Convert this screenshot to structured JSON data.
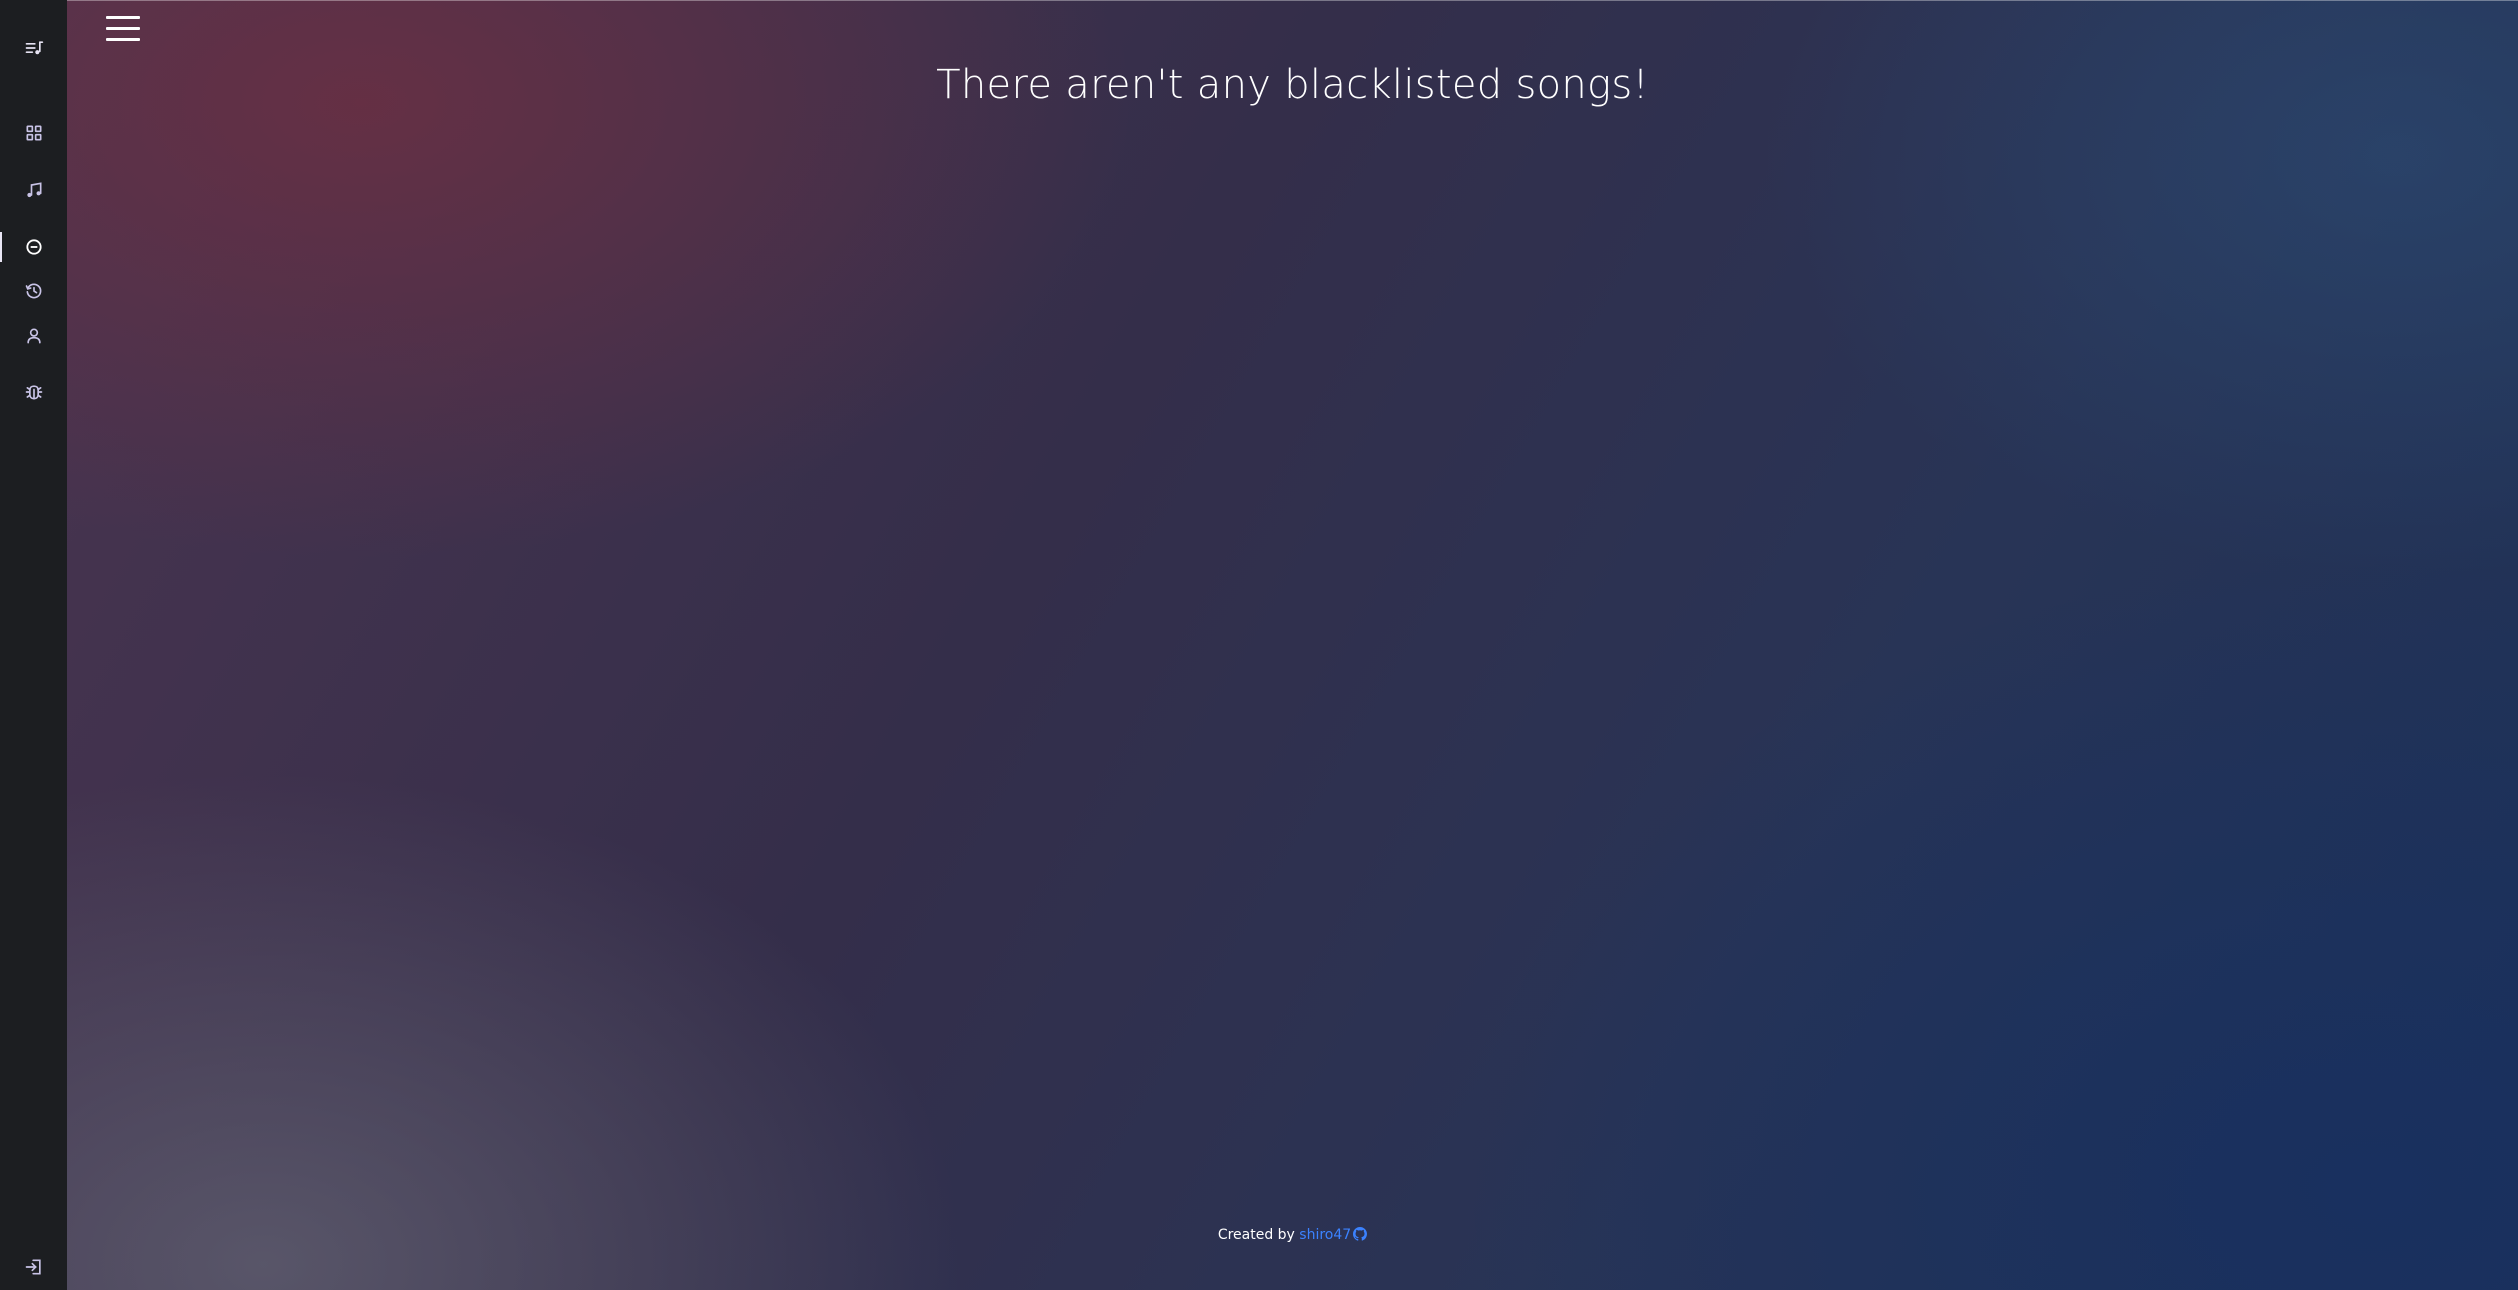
{
  "page": {
    "empty_message": "There aren't any blacklisted songs!"
  },
  "sidebar": {
    "items": [
      {
        "name": "logo",
        "icon": "playlist-music-icon",
        "active": false
      },
      {
        "name": "dashboard",
        "icon": "grid-icon",
        "active": false
      },
      {
        "name": "songs",
        "icon": "music-note-icon",
        "active": false
      },
      {
        "name": "blacklist",
        "icon": "minus-circle-icon",
        "active": true
      },
      {
        "name": "history",
        "icon": "history-icon",
        "active": false
      },
      {
        "name": "profile",
        "icon": "user-icon",
        "active": false
      },
      {
        "name": "debug",
        "icon": "bug-icon",
        "active": false
      }
    ],
    "bottom_item": {
      "name": "logout",
      "icon": "logout-icon"
    }
  },
  "header": {
    "menu_icon": "hamburger-icon"
  },
  "footer": {
    "prefix": "Created by",
    "author": "shiro47",
    "icon": "github-icon",
    "link_color": "#3b82ff"
  },
  "colors": {
    "sidebar_bg": "#1c1e21",
    "icon_color": "#c8c3e6",
    "active_indicator": "#e9e6f5",
    "text": "#ffffff"
  }
}
